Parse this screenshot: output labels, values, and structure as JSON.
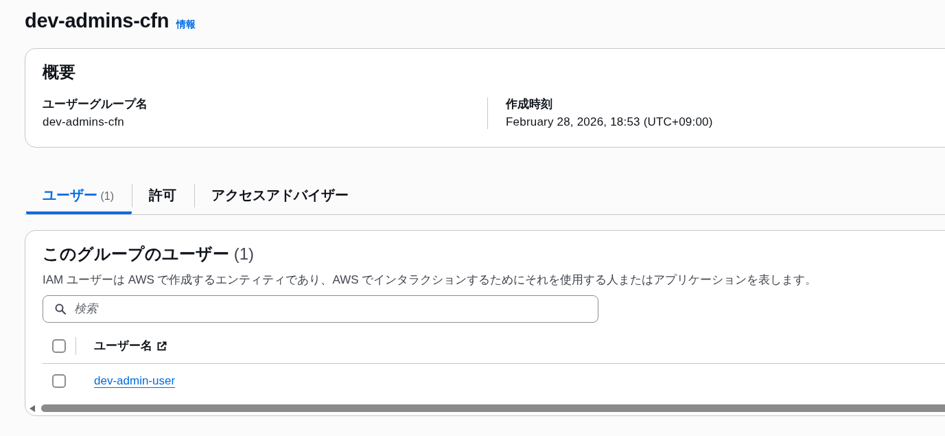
{
  "page": {
    "title": "dev-admins-cfn",
    "info_link": "情報"
  },
  "overview": {
    "heading": "概要",
    "fields": [
      {
        "label": "ユーザーグループ名",
        "value": "dev-admins-cfn"
      },
      {
        "label": "作成時刻",
        "value": "February 28, 2026, 18:53 (UTC+09:00)"
      }
    ]
  },
  "tabs": [
    {
      "label": "ユーザー",
      "count": "(1)",
      "selected": true
    },
    {
      "label": "許可",
      "selected": false
    },
    {
      "label": "アクセスアドバイザー",
      "selected": false
    }
  ],
  "users_panel": {
    "heading": "このグループのユーザー",
    "count": "(1)",
    "description": "IAM ユーザーは AWS で作成するエンティティであり、AWS でインタラクションするためにそれを使用する人またはアプリケーションを表します。",
    "search": {
      "placeholder": "検索"
    },
    "table": {
      "header_checked": false,
      "columns": [
        {
          "label": "ユーザー名"
        }
      ],
      "rows": [
        {
          "user_name": "dev-admin-user",
          "checked": false
        }
      ]
    }
  }
}
